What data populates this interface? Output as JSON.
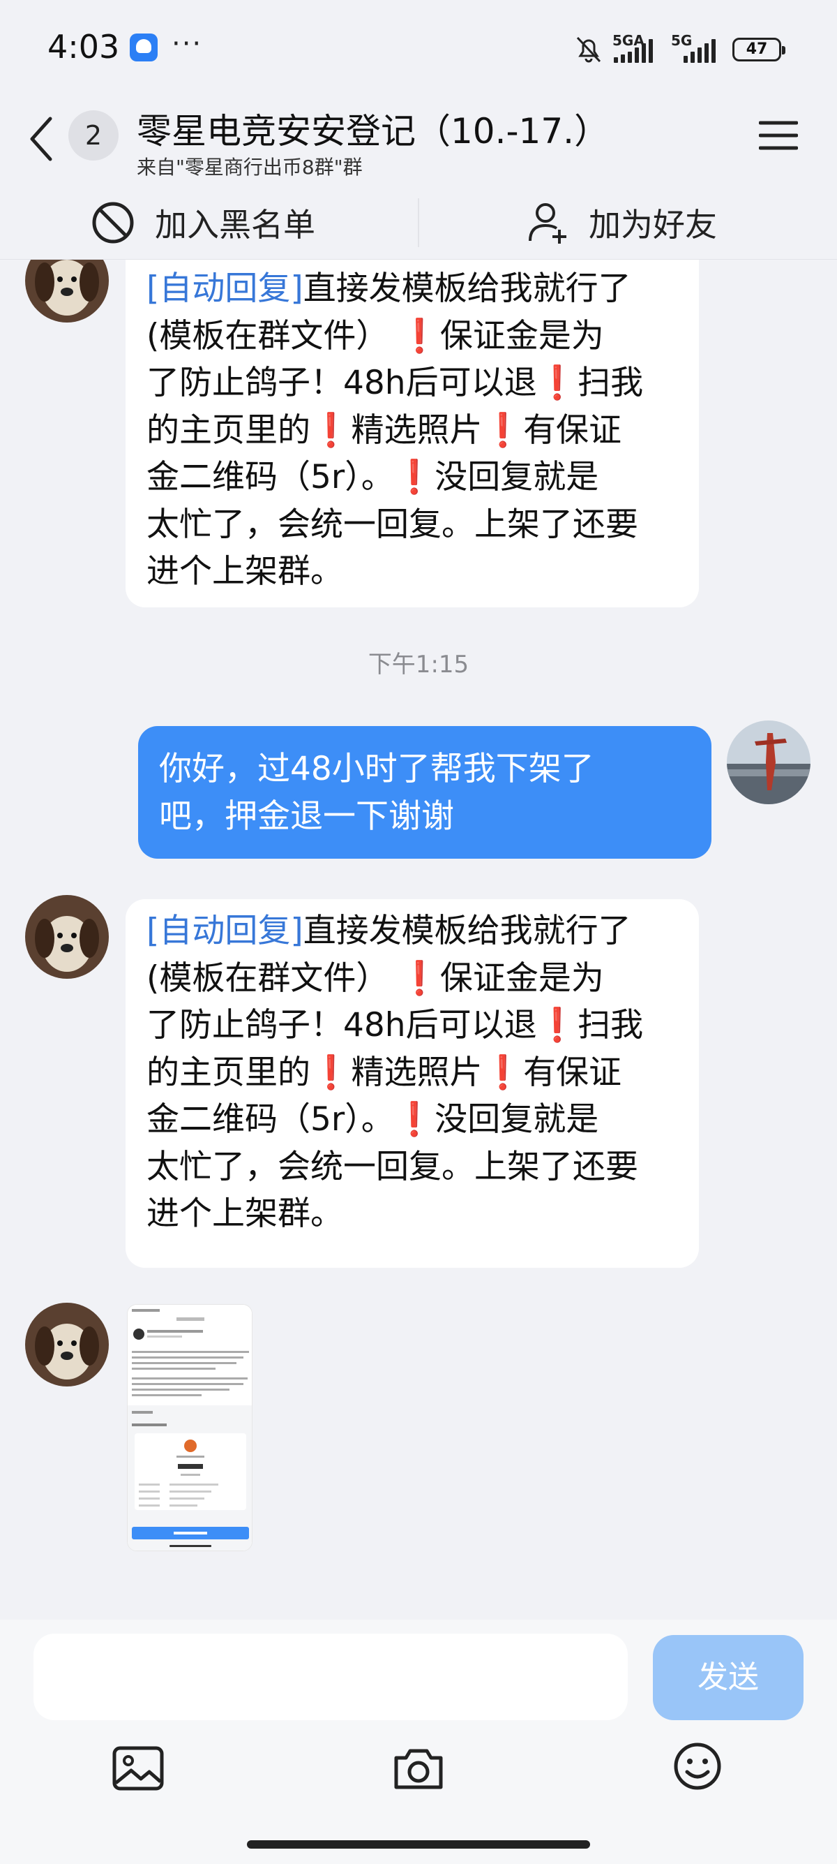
{
  "status_bar": {
    "time": "4:03",
    "more": "···",
    "sim1_label": "5GA",
    "sim2_label": "5G",
    "battery": "47"
  },
  "header": {
    "unread_count": "2",
    "title": "零星电竞安安登记（10.-17.）",
    "subtitle": "来自\"零星商行出币8群\"群",
    "back_icon": "chevron-left-icon",
    "menu_icon": "hamburger-menu-icon"
  },
  "actions": {
    "block": "加入黑名单",
    "add_friend": "加为好友"
  },
  "messages": {
    "auto_reply_1": {
      "lines": [
        {
          "a": "[自动回复]",
          "b": "直接发模板给我就行了"
        },
        {
          "a": "(模板在群文件）",
          "b": "保证金是为"
        },
        {
          "a": "了防止鸽子！48h后可以退",
          "b": "扫我"
        },
        {
          "a": "的主页里的",
          "b": "精选照片",
          "c": "有保证"
        },
        {
          "a": "金二维码（5r）。",
          "b": "没回复就是"
        },
        {
          "a": "太忙了，会统一回复。上架了还要"
        },
        {
          "a": "进个上架群。"
        }
      ]
    },
    "timestamp": "下午1:15",
    "outgoing": {
      "lines": [
        "你好，过48小时了帮我下架了",
        "吧，押金退一下谢谢"
      ]
    },
    "auto_reply_2": {
      "lines": [
        {
          "a": "[自动回复]",
          "b": "直接发模板给我就行了"
        },
        {
          "a": "(模板在群文件）",
          "b": "保证金是为"
        },
        {
          "a": "了防止鸽子！48h后可以退",
          "b": "扫我"
        },
        {
          "a": "的主页里的",
          "b": "精选照片",
          "c": "有保证"
        },
        {
          "a": "金二维码（5r）。",
          "b": "没回复就是"
        },
        {
          "a": "太忙了，会统一回复。上架了还要"
        },
        {
          "a": "进个上架群。"
        }
      ]
    },
    "exclamation": "❗"
  },
  "composer": {
    "placeholder": "",
    "send_label": "发送"
  }
}
